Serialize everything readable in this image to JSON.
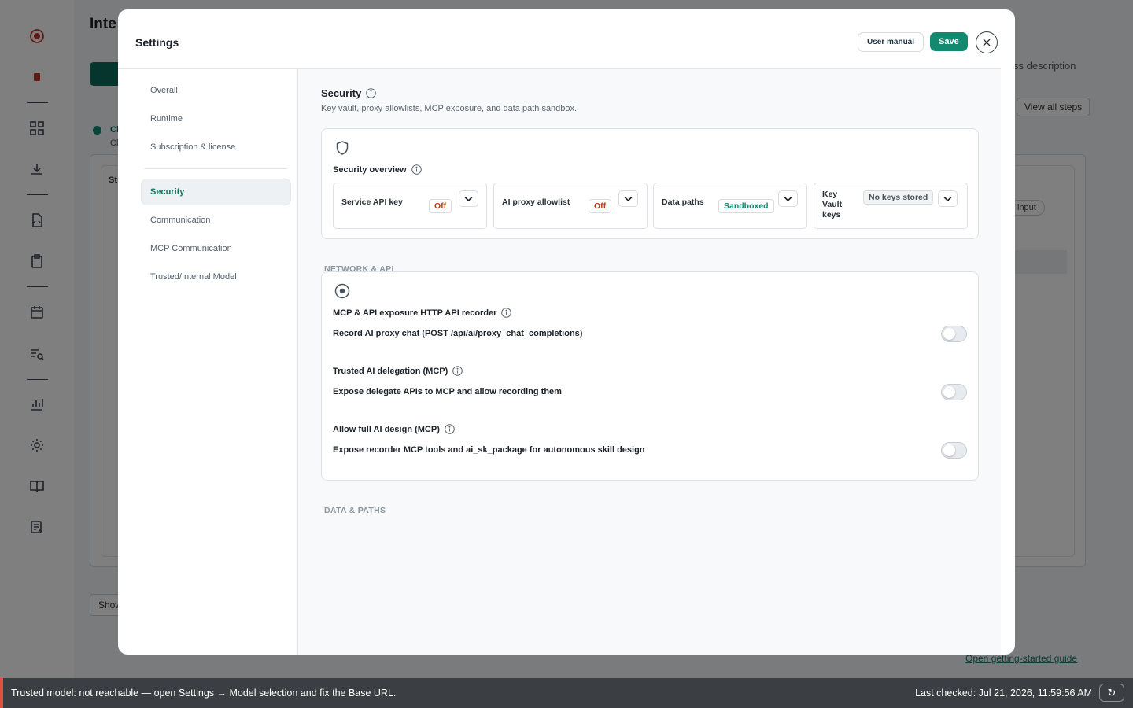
{
  "background": {
    "title": "Inte",
    "right_text": "ss description",
    "view_all_label": "View all steps",
    "row_label_a": "Cl",
    "row_label_b": "Cl",
    "inner_label": "St",
    "chip_label": "input",
    "show_label": "Show",
    "guide_link": "Open getting-started guide"
  },
  "modal": {
    "title": "Settings",
    "manual_label": "User manual",
    "save_label": "Save"
  },
  "nav": {
    "items": [
      "Overall",
      "Runtime",
      "Subscription & license",
      "Security",
      "Communication",
      "MCP Communication",
      "Trusted/Internal Model"
    ],
    "active": "Security"
  },
  "section": {
    "title": "Security",
    "description": "Key vault, proxy allowlists, MCP exposure, and data path sandbox."
  },
  "overview": {
    "label": "Security overview",
    "tiles": [
      {
        "label": "Service API key",
        "status": "Off"
      },
      {
        "label": "AI proxy allowlist",
        "status": "Off"
      },
      {
        "label": "Data paths",
        "status": "Sandboxed"
      },
      {
        "label": "Key Vault keys",
        "status": "No keys stored"
      }
    ]
  },
  "network": {
    "heading": "NETWORK & API",
    "rows": [
      {
        "title": "MCP & API exposure HTTP API recorder",
        "text": "Record AI proxy chat (POST /api/ai/proxy_chat_completions)",
        "enabled": false
      },
      {
        "title": "Trusted AI delegation (MCP)",
        "text": "Expose delegate APIs to MCP and allow recording them",
        "enabled": false
      },
      {
        "title": "Allow full AI design (MCP)",
        "text": "Expose recorder MCP tools and ai_sk_package for autonomous skill design",
        "enabled": false
      }
    ]
  },
  "data_paths": {
    "heading": "DATA & PATHS"
  },
  "status_bar": {
    "message": "Trusted model: not reachable — open Settings → Model selection and fix the Base URL.",
    "last_checked": "Last checked: Jul 21, 2026, 11:59:56 AM",
    "refresh_icon": "↻"
  },
  "colors": {
    "accent": "#138a70",
    "off": "#b83c11",
    "error": "#e0533b"
  }
}
